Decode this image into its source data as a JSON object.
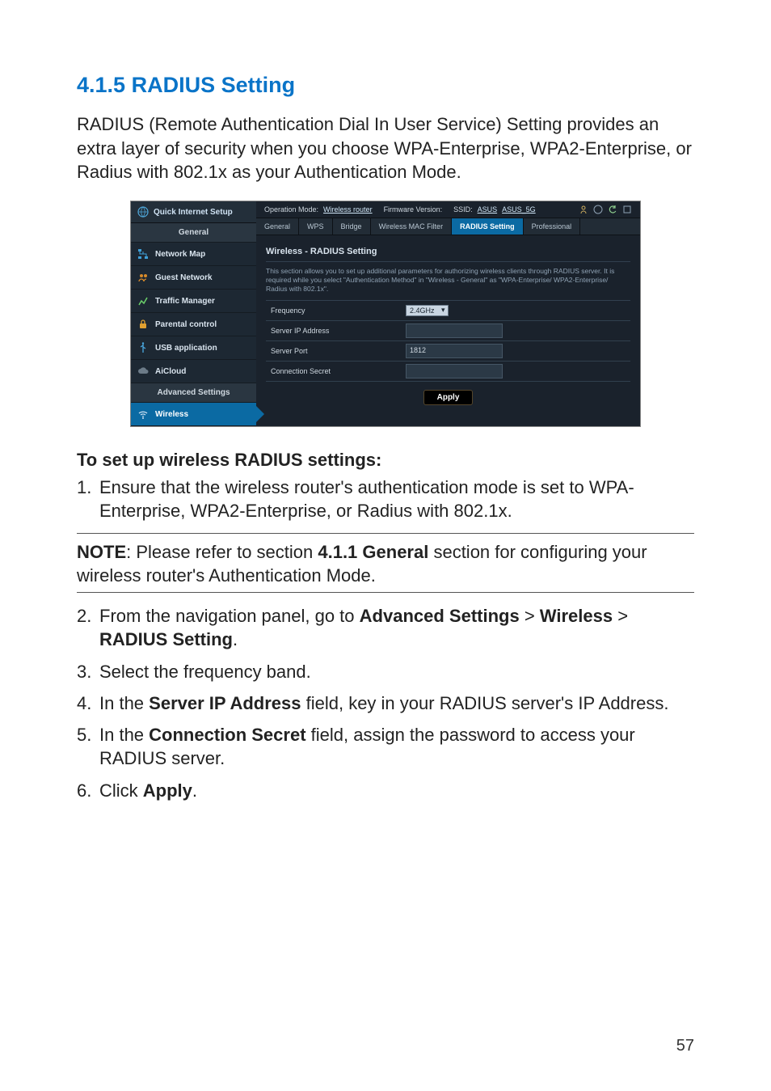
{
  "section_number": "4.1.5",
  "section_title": "RADIUS Setting",
  "lead_paragraph": "RADIUS (Remote Authentication Dial In User Service) Setting provides an extra layer of security when you choose WPA-Enterprise, WPA2-Enterprise, or Radius with 802.1x as your Authentication Mode.",
  "screenshot": {
    "top": {
      "op_mode_label": "Operation Mode:",
      "op_mode_value": "Wireless router",
      "fw_label": "Firmware Version:",
      "ssid_label": "SSID:",
      "ssid1": "ASUS",
      "ssid2": "ASUS_5G"
    },
    "sidebar": {
      "quick_internet_setup": "Quick Internet Setup",
      "cat_general": "General",
      "items_general": [
        "Network Map",
        "Guest Network",
        "Traffic Manager",
        "Parental control",
        "USB application",
        "AiCloud"
      ],
      "cat_advanced": "Advanced Settings",
      "items_advanced": [
        "Wireless"
      ]
    },
    "tabs": [
      "General",
      "WPS",
      "Bridge",
      "Wireless MAC Filter",
      "RADIUS Setting",
      "Professional"
    ],
    "active_tab_index": 4,
    "panel_title": "Wireless - RADIUS Setting",
    "panel_desc": "This section allows you to set up additional parameters for authorizing wireless clients through RADIUS server. It is required while you select \"Authentication Method\" in \"Wireless - General\" as \"WPA-Enterprise/ WPA2-Enterprise/ Radius with 802.1x\".",
    "rows": {
      "frequency_label": "Frequency",
      "frequency_value": "2.4GHz",
      "server_ip_label": "Server IP Address",
      "server_ip_value": "",
      "server_port_label": "Server Port",
      "server_port_value": "1812",
      "conn_secret_label": "Connection Secret",
      "conn_secret_value": ""
    },
    "apply_label": "Apply"
  },
  "instructions_title": "To set up wireless RADIUS settings:",
  "steps": {
    "s1": "Ensure that the wireless router's authentication mode is set to WPA-Enterprise, WPA2-Enterprise, or Radius with 802.1x.",
    "note_prefix": "NOTE",
    "note_body1": ":  Please refer to section ",
    "note_bold": "4.1.1 General",
    "note_body2": " section for configuring your wireless router's Authentication Mode.",
    "s2_a": "From the navigation panel, go to ",
    "s2_b": "Advanced Settings",
    "s2_c": " > ",
    "s2_d": "Wireless",
    "s2_e": " > ",
    "s2_f": "RADIUS Setting",
    "s2_g": ".",
    "s3": "Select the frequency band.",
    "s4_a": "In the ",
    "s4_b": "Server IP Address",
    "s4_c": " field, key in your RADIUS server's IP Address.",
    "s5_a": "In the ",
    "s5_b": "Connection Secret",
    "s5_c": " field, assign the password to access your RADIUS server.",
    "s6_a": "Click ",
    "s6_b": "Apply",
    "s6_c": "."
  },
  "page_number": "57"
}
